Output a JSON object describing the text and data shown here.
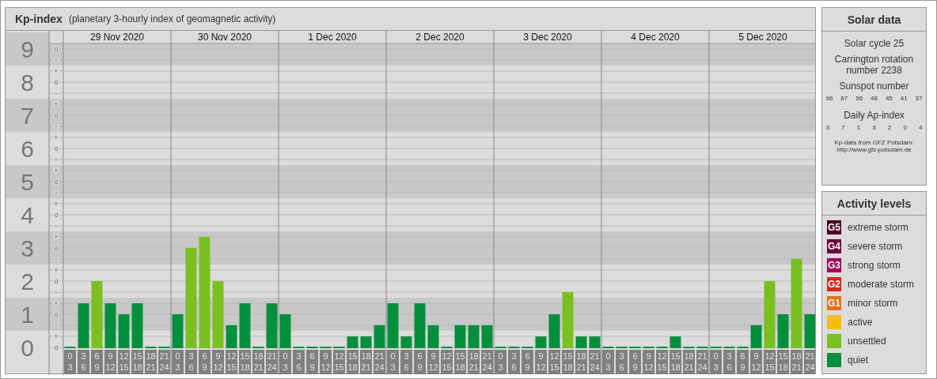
{
  "kp_panel": {
    "title": "Kp-index",
    "subtitle": "(planetary 3-hourly index of geomagnetic activity)",
    "y_subticks": [
      "o",
      "−",
      "+",
      "o",
      "−",
      "+",
      "o",
      "−",
      "+",
      "o",
      "−",
      "+",
      "o",
      "−",
      "+",
      "o",
      "−",
      "+",
      "o",
      "−",
      "+",
      "o",
      "−",
      "+",
      "o",
      "−",
      "+",
      "o"
    ],
    "days": [
      "29 Nov 2020",
      "30 Nov 2020",
      "1 Dec 2020",
      "2 Dec 2020",
      "3 Dec 2020",
      "4 Dec 2020",
      "5 Dec 2020"
    ],
    "chart_data": {
      "type": "bar",
      "grid": true,
      "ylim": [
        0,
        9
      ],
      "yticks": [
        0,
        1,
        2,
        3,
        4,
        5,
        6,
        7,
        8,
        9
      ],
      "categories": [
        "0\n3",
        "3\n6",
        "6\n9",
        "9\n12",
        "12\n15",
        "15\n18",
        "18\n21",
        "21\n24",
        "0\n3",
        "3\n6",
        "6\n9",
        "9\n12",
        "12\n15",
        "15\n18",
        "18\n21",
        "21\n24",
        "0\n3",
        "3\n6",
        "6\n9",
        "9\n12",
        "12\n15",
        "15\n18",
        "18\n21",
        "21\n24",
        "0\n3",
        "3\n6",
        "6\n9",
        "9\n12",
        "12\n15",
        "15\n18",
        "18\n21",
        "21\n24",
        "0\n3",
        "3\n6",
        "6\n9",
        "9\n12",
        "12\n15",
        "15\n18",
        "18\n21",
        "21\n24",
        "0\n3",
        "3\n6",
        "6\n9",
        "9\n12",
        "12\n15",
        "15\n18",
        "18\n21",
        "21\n24",
        "0\n3",
        "3\n6",
        "6\n9",
        "9\n12",
        "12\n15",
        "15\n18",
        "18\n21",
        "21\n24"
      ],
      "series": [
        {
          "color": "#008f3c",
          "values": [
            0,
            1.33,
            null,
            1.33,
            1,
            1.33,
            0,
            0,
            1,
            null,
            null,
            null,
            0.67,
            1.33,
            0,
            1.33,
            1,
            0,
            0,
            0,
            0,
            0.33,
            0.33,
            0.67,
            1.33,
            0.33,
            1.33,
            0.67,
            0,
            0.67,
            0.67,
            0.67,
            0,
            0,
            0,
            0.33,
            1,
            null,
            0.33,
            0.33,
            0,
            0,
            0,
            0,
            0,
            0.33,
            0,
            0,
            0,
            0,
            0,
            0.67,
            null,
            1,
            null,
            1
          ]
        },
        {
          "color": "#7bc021",
          "values": [
            null,
            null,
            2,
            null,
            null,
            null,
            null,
            null,
            null,
            3,
            3.33,
            2,
            null,
            null,
            null,
            null,
            null,
            null,
            null,
            null,
            null,
            null,
            null,
            null,
            null,
            null,
            null,
            null,
            null,
            null,
            null,
            null,
            null,
            null,
            null,
            null,
            null,
            1.67,
            null,
            null,
            null,
            null,
            null,
            null,
            null,
            null,
            null,
            null,
            null,
            null,
            null,
            null,
            2,
            null,
            2.67,
            null
          ]
        }
      ]
    }
  },
  "solar_data": {
    "title": "Solar data",
    "solar_cycle": "Solar cycle 25",
    "carrington": "Carrington rotation number 2238",
    "sunspot_heading": "Sunspot number",
    "sunspot_numbers": [
      "96",
      "87",
      "56",
      "48",
      "45",
      "41",
      "37"
    ],
    "ap_heading": "Daily Ap-index",
    "ap_values": [
      "3",
      "7",
      "1",
      "3",
      "2",
      "0",
      "4"
    ],
    "credit": [
      "Kp-data from GFZ Potsdam:",
      "http://www.gfz-potsdam.de"
    ]
  },
  "activity_levels": {
    "title": "Activity levels",
    "items": [
      {
        "badge": "G5",
        "label": "extreme storm",
        "color": "#4a0026"
      },
      {
        "badge": "G4",
        "label": "severe storm",
        "color": "#6b0040"
      },
      {
        "badge": "G3",
        "label": "strong storm",
        "color": "#a0005c"
      },
      {
        "badge": "G2",
        "label": "moderate storm",
        "color": "#d4281c"
      },
      {
        "badge": "G1",
        "label": "minor storm",
        "color": "#e07418"
      },
      {
        "label": "active",
        "color": "#f5c000"
      },
      {
        "label": "unsettled",
        "color": "#7bc021"
      },
      {
        "label": "quiet",
        "color": "#008f3c"
      }
    ]
  }
}
